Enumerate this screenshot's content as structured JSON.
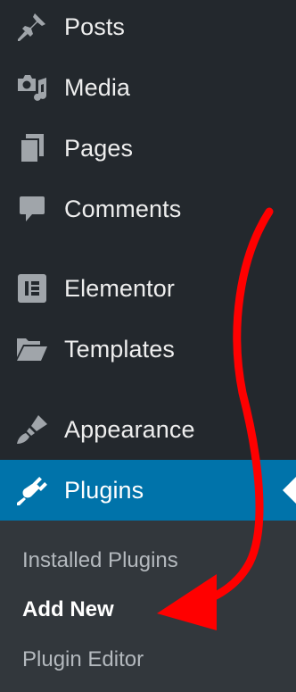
{
  "menu": {
    "items": [
      {
        "label": "Posts",
        "icon": "pin-icon"
      },
      {
        "label": "Media",
        "icon": "camera-music-icon"
      },
      {
        "label": "Pages",
        "icon": "pages-icon"
      },
      {
        "label": "Comments",
        "icon": "comment-bubble-icon"
      },
      {
        "label": "Elementor",
        "icon": "elementor-icon"
      },
      {
        "label": "Templates",
        "icon": "folder-open-icon"
      },
      {
        "label": "Appearance",
        "icon": "paintbrush-icon"
      },
      {
        "label": "Plugins",
        "icon": "plug-icon",
        "active": true
      }
    ]
  },
  "submenu": {
    "items": [
      {
        "label": "Installed Plugins"
      },
      {
        "label": "Add New",
        "current": true
      },
      {
        "label": "Plugin Editor"
      }
    ]
  },
  "colors": {
    "sidebar_bg": "#23282d",
    "submenu_bg": "#32373c",
    "active_bg": "#0073aa",
    "text": "#eeeeee",
    "submenu_text": "#b4b9be",
    "annotation_arrow": "#ff0000"
  }
}
